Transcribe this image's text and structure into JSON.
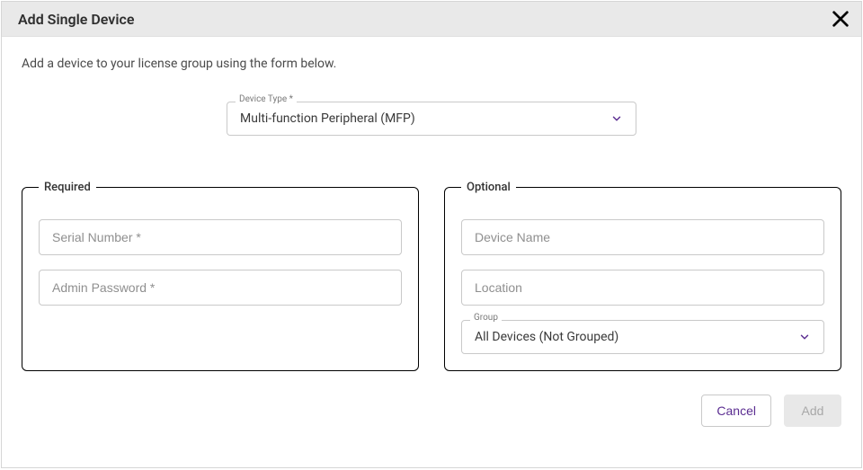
{
  "dialog": {
    "title": "Add Single Device",
    "intro": "Add a device to your license group using the form below."
  },
  "deviceType": {
    "label": "Device Type *",
    "value": "Multi-function Peripheral (MFP)"
  },
  "required": {
    "legend": "Required",
    "serialPlaceholder": "Serial Number *",
    "adminPlaceholder": "Admin Password *"
  },
  "optional": {
    "legend": "Optional",
    "namePlaceholder": "Device Name",
    "locationPlaceholder": "Location",
    "groupLabel": "Group",
    "groupValue": "All Devices (Not Grouped)"
  },
  "footer": {
    "cancel": "Cancel",
    "add": "Add"
  }
}
